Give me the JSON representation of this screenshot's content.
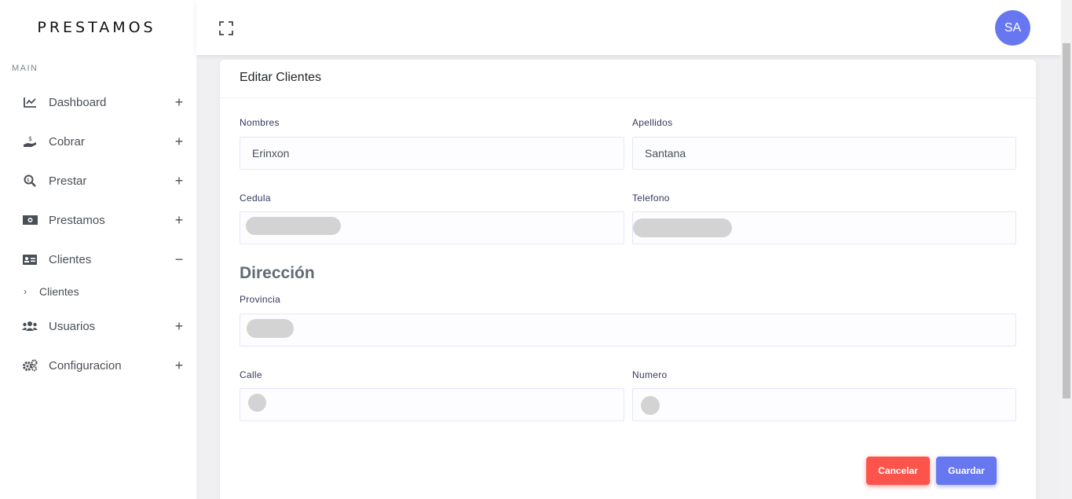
{
  "brand": "PRESTAMOS",
  "sidebar": {
    "section_label": "MAIN",
    "items": [
      {
        "label": "Dashboard",
        "toggle": "+",
        "icon": "chart-line-icon"
      },
      {
        "label": "Cobrar",
        "toggle": "+",
        "icon": "hand-dollar-icon"
      },
      {
        "label": "Prestar",
        "toggle": "+",
        "icon": "search-dollar-icon"
      },
      {
        "label": "Prestamos",
        "toggle": "+",
        "icon": "money-bill-icon"
      },
      {
        "label": "Clientes",
        "toggle": "−",
        "icon": "id-card-icon"
      },
      {
        "label": "Usuarios",
        "toggle": "+",
        "icon": "users-icon"
      },
      {
        "label": "Configuracion",
        "toggle": "+",
        "icon": "gears-icon"
      }
    ],
    "subitems": [
      {
        "label": "Clientes",
        "chevron": "›"
      }
    ]
  },
  "header": {
    "avatar_initials": "SA"
  },
  "form": {
    "title": "Editar Clientes",
    "nombres_label": "Nombres",
    "nombres_value": "Erinxon",
    "apellidos_label": "Apellidos",
    "apellidos_value": "Santana",
    "cedula_label": "Cedula",
    "telefono_label": "Telefono",
    "direccion_title": "Dirección",
    "provincia_label": "Provincia",
    "calle_label": "Calle",
    "numero_label": "Numero",
    "cancel_label": "Cancelar",
    "save_label": "Guardar"
  },
  "colors": {
    "primary": "#6777ef",
    "danger": "#fc544b"
  }
}
